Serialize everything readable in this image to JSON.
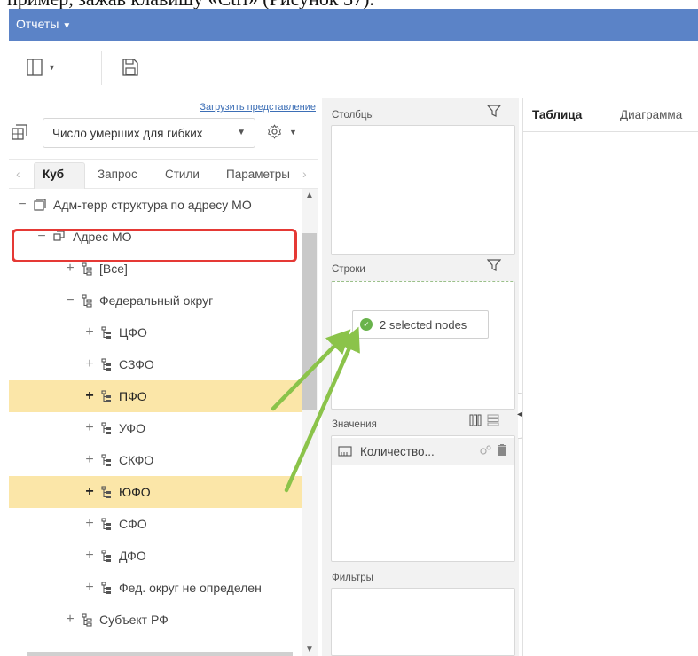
{
  "doc_fragment": "пример, зажав клавишу «Ctrl» (Рисунок 37).",
  "topbar": {
    "menu_label": "Отчеты"
  },
  "left_panel": {
    "load_view_link": "Загрузить представление",
    "cube_select_value": "Число умерших для гибких",
    "tabs": [
      "Куб",
      "Запрос",
      "Стили",
      "Параметры"
    ],
    "active_tab": "Куб"
  },
  "tree": [
    {
      "toggle": "−",
      "label": "Адм-терр структура по адресу МО",
      "icon": "cube-dimension-icon",
      "highlight": false
    },
    {
      "toggle": "−",
      "label": "Адрес МО",
      "icon": "hierarchy-icon",
      "highlight": false,
      "boxed": true
    },
    {
      "toggle": "+",
      "label": "[Все]",
      "icon": "level-icon",
      "highlight": false
    },
    {
      "toggle": "−",
      "label": "Федеральный округ",
      "icon": "level-icon",
      "highlight": false
    },
    {
      "toggle": "+",
      "label": "ЦФО",
      "icon": "member-icon",
      "highlight": false
    },
    {
      "toggle": "+",
      "label": "СЗФО",
      "icon": "member-icon",
      "highlight": false
    },
    {
      "toggle": "+",
      "label": "ПФО",
      "icon": "member-icon",
      "highlight": true
    },
    {
      "toggle": "+",
      "label": "УФО",
      "icon": "member-icon",
      "highlight": false
    },
    {
      "toggle": "+",
      "label": "СКФО",
      "icon": "member-icon",
      "highlight": false
    },
    {
      "toggle": "+",
      "label": "ЮФО",
      "icon": "member-icon",
      "highlight": true
    },
    {
      "toggle": "+",
      "label": "СФО",
      "icon": "member-icon",
      "highlight": false
    },
    {
      "toggle": "+",
      "label": "ДФО",
      "icon": "member-icon",
      "highlight": false
    },
    {
      "toggle": "+",
      "label": "Фед. округ не определен",
      "icon": "member-icon",
      "highlight": false
    },
    {
      "toggle": "+",
      "label": "Субъект РФ",
      "icon": "level-icon",
      "highlight": false
    }
  ],
  "middle_panel": {
    "columns_title": "Столбцы",
    "rows_title": "Строки",
    "drag_chip": "2 selected nodes",
    "values_title": "Значения",
    "values_item": "Количество...",
    "filters_title": "Фильтры"
  },
  "right_panel": {
    "tabs": [
      "Таблица",
      "Диаграмма"
    ],
    "active_tab": "Таблица"
  },
  "colors": {
    "topbar": "#5b83c7",
    "highlight": "#fbe6a8",
    "red_box": "#e53935",
    "arrow": "#8bc34a",
    "check": "#69b34c"
  }
}
